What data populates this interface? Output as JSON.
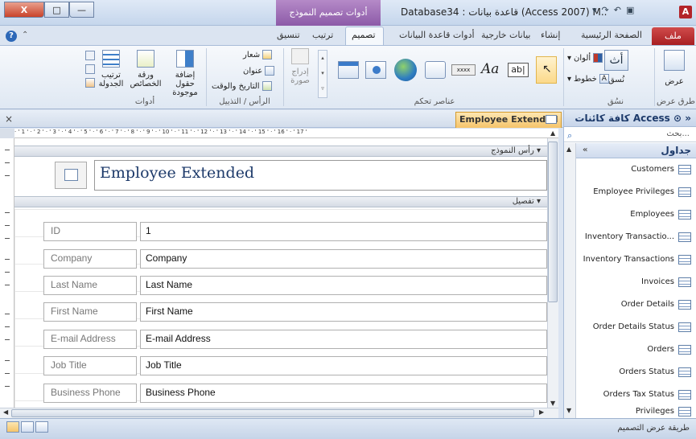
{
  "window": {
    "title": "Database34 : قاعدة بيانات (Access 2007) M..",
    "contextual_tab": "أدوات تصميم النموذج",
    "app_icon": "A",
    "close_glyph": "X",
    "maximize_glyph": "□",
    "minimize_glyph": "—"
  },
  "tabs": {
    "file": "ملف",
    "home": "الصفحة الرئيسية",
    "create": "إنشاء",
    "external": "بيانات خارجية",
    "db_tools": "أدوات قاعدة البيانات",
    "design": "تصميم",
    "arrange": "ترتيب",
    "format": "تنسيق"
  },
  "ribbon": {
    "views": {
      "view_label": "عرض",
      "group": "طرق عرض"
    },
    "themes": {
      "themes_label": "نُسق",
      "colors": "ألوان",
      "fonts": "خطوط",
      "group": "نسُق"
    },
    "controls": {
      "group": "عناصر تحكم",
      "insert_image": "إدراج صورة",
      "button_text": "xxxx",
      "label_text": "Aa",
      "textbox_text": "ab|"
    },
    "header_footer": {
      "logo": "شعار",
      "title": "عنوان",
      "datetime": "التاريخ والوقت",
      "group": "الرأس / التذييل"
    },
    "tools": {
      "add_fields": "إضافة حقول موجودة",
      "property_sheet": "ورقة الخصائص",
      "tab_order": "ترتيب الجدولة",
      "group": "أدوات"
    }
  },
  "document": {
    "close_glyph": "×",
    "tab_label": "Employee Extended",
    "ruler_text": "· ' 1 ' · ' 2 ' · ' 3 ' · ' 4 ' · ' 5 ' · ' 6 ' · ' 7 ' · ' 8 ' · ' 9 ' · ' 10 ' · ' 11 ' · ' 12 ' · ' 13 ' · ' 14 ' · ' 15 ' · ' 16 ' · ' 17 '",
    "form_header_label": "رأس النموذج",
    "detail_label": "تفصيل",
    "form_title": "Employee Extended",
    "fields": [
      {
        "label": "ID",
        "value": "1"
      },
      {
        "label": "Company",
        "value": "Company"
      },
      {
        "label": "Last Name",
        "value": "Last Name"
      },
      {
        "label": "First Name",
        "value": "First Name"
      },
      {
        "label": "E-mail Address",
        "value": "E-mail Address"
      },
      {
        "label": "Job Title",
        "value": "Job Title"
      },
      {
        "label": "Business Phone",
        "value": "Business Phone"
      }
    ]
  },
  "nav": {
    "header": "كافة كائنات Access",
    "search_placeholder": "بحث...",
    "group": "جداول",
    "items": [
      "Customers",
      "Employee Privileges",
      "Employees",
      "Inventory Transactio...",
      "Inventory Transactions",
      "Invoices",
      "Order Details",
      "Order Details Status",
      "Orders",
      "Orders Status",
      "Orders Tax Status",
      "Privileges"
    ]
  },
  "status": {
    "text": "طريقة عرض التصميم"
  },
  "colors": {
    "file_tab": "#b32b2b",
    "contextual": "#8c5aa8",
    "doc_tab": "#f5c46a",
    "title_text": "#1d3a6a"
  }
}
